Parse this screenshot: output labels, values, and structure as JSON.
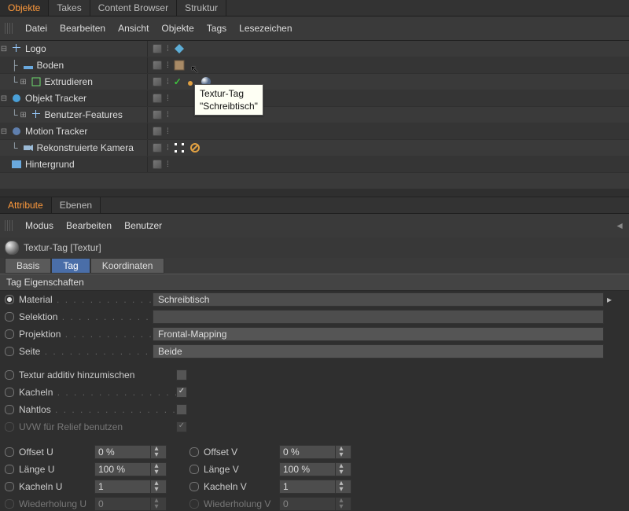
{
  "tabs": {
    "objekte": "Objekte",
    "takes": "Takes",
    "content": "Content Browser",
    "struktur": "Struktur"
  },
  "obj_menu": {
    "datei": "Datei",
    "bearbeiten": "Bearbeiten",
    "ansicht": "Ansicht",
    "objekte": "Objekte",
    "tags": "Tags",
    "lesezeichen": "Lesezeichen"
  },
  "tree": {
    "logo": "Logo",
    "boden": "Boden",
    "extrudieren": "Extrudieren",
    "objtracker": "Objekt Tracker",
    "benutzer": "Benutzer-Features",
    "motion": "Motion Tracker",
    "rekon": "Rekonstruierte Kamera",
    "hintergrund": "Hintergrund"
  },
  "tooltip": {
    "l1": "Textur-Tag",
    "l2": "\"Schreibtisch\""
  },
  "attr_tabs": {
    "attribute": "Attribute",
    "ebenen": "Ebenen"
  },
  "attr_menu": {
    "modus": "Modus",
    "bearbeiten": "Bearbeiten",
    "benutzer": "Benutzer"
  },
  "attr_title": "Textur-Tag [Textur]",
  "subtabs": {
    "basis": "Basis",
    "tag": "Tag",
    "koord": "Koordinaten"
  },
  "section": "Tag Eigenschaften",
  "labels": {
    "material": "Material",
    "selektion": "Selektion",
    "projektion": "Projektion",
    "seite": "Seite",
    "additiv": "Textur additiv hinzumischen",
    "kacheln": "Kacheln",
    "nahtlos": "Nahtlos",
    "uvw": "UVW für Relief benutzen",
    "offsetu": "Offset U",
    "offsetv": "Offset V",
    "laengeu": "Länge U",
    "laengev": "Länge V",
    "kachelnu": "Kacheln U",
    "kachelnv": "Kacheln V",
    "wiedu": "Wiederholung U",
    "wiedv": "Wiederholung V"
  },
  "values": {
    "material": "Schreibtisch",
    "projektion": "Frontal-Mapping",
    "seite": "Beide",
    "offsetu": "0 %",
    "offsetv": "0 %",
    "laengeu": "100 %",
    "laengev": "100 %",
    "kachelnu": "1",
    "kachelnv": "1",
    "wiedu": "0",
    "wiedv": "0"
  }
}
